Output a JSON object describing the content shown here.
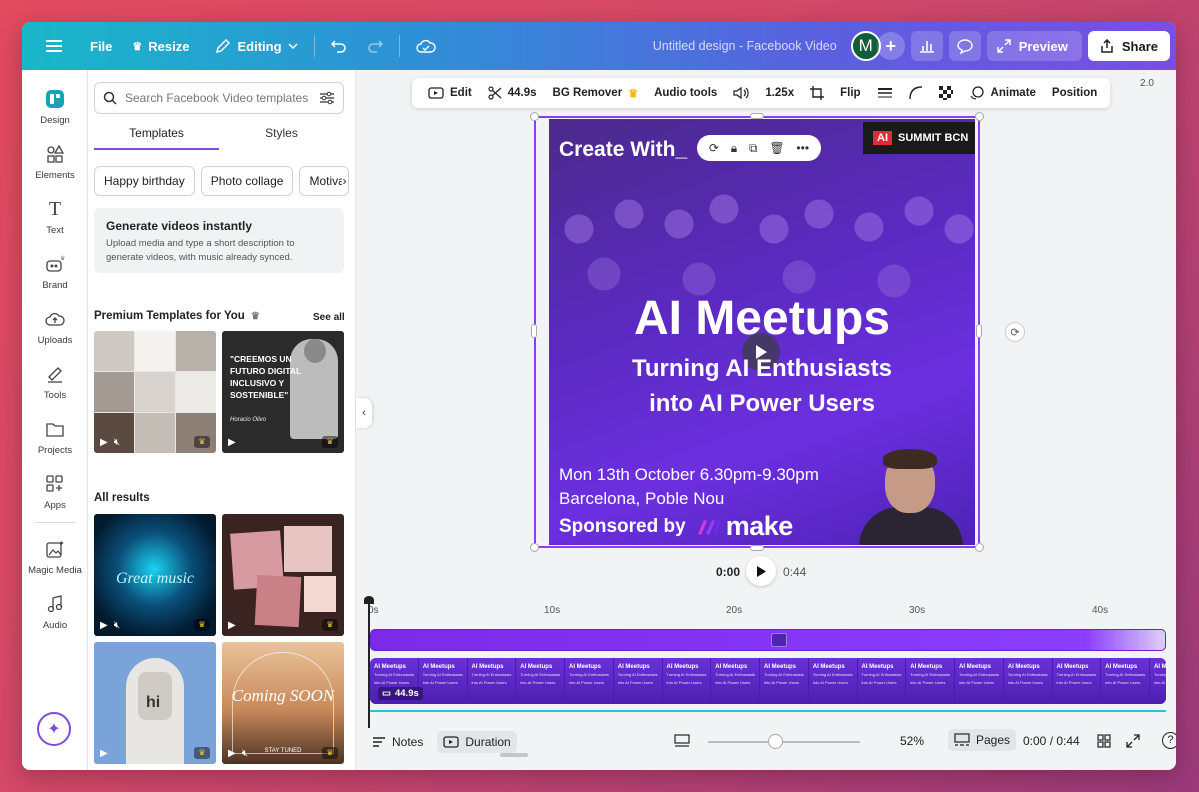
{
  "topbar": {
    "file": "File",
    "resize": "Resize",
    "editing": "Editing",
    "title": "Untitled design - Facebook Video",
    "avatar_initial": "M",
    "preview": "Preview",
    "share": "Share"
  },
  "rail": {
    "items": [
      {
        "label": "Design",
        "icon": "design-icon"
      },
      {
        "label": "Elements",
        "icon": "elements-icon"
      },
      {
        "label": "Text",
        "icon": "text-icon"
      },
      {
        "label": "Brand",
        "icon": "brand-icon"
      },
      {
        "label": "Uploads",
        "icon": "uploads-icon"
      },
      {
        "label": "Tools",
        "icon": "tools-icon"
      },
      {
        "label": "Projects",
        "icon": "projects-icon"
      },
      {
        "label": "Apps",
        "icon": "apps-icon"
      },
      {
        "label": "Magic Media",
        "icon": "magic-media-icon"
      },
      {
        "label": "Audio",
        "icon": "audio-icon"
      }
    ]
  },
  "panel": {
    "search_placeholder": "Search Facebook Video templates",
    "tabs": [
      "Templates",
      "Styles"
    ],
    "chips": [
      "Happy birthday",
      "Photo collage",
      "Motiva"
    ],
    "generate": {
      "title": "Generate videos instantly",
      "desc": "Upload media and type a short description to generate videos, with music already synced."
    },
    "premium_title": "Premium Templates for You",
    "see_all": "See all",
    "all_results": "All results",
    "template_quote": "\"CREEMOS UN FUTURO DIGITAL INCLUSIVO Y SOSTENIBLE\"",
    "template_sign": "Horacio Olivo",
    "great_music": "Great music",
    "coming_soon": "Coming SOON",
    "stay_tuned": "STAY TUNED"
  },
  "ctx": {
    "edit": "Edit",
    "duration": "44.9s",
    "bg_remover": "BG Remover",
    "audio_tools": "Audio tools",
    "speed": "1.25x",
    "flip": "Flip",
    "animate": "Animate",
    "position": "Position",
    "zoom_chip": "2.0"
  },
  "design": {
    "create_with": "Create With_",
    "summit_ai": "AI",
    "summit_text": "SUMMIT BCN",
    "title": "AI Meetups",
    "sub1": "Turning AI Enthusiasts",
    "sub2": "into AI Power Users",
    "date": "Mon 13th October 6.30pm-9.30pm",
    "place": "Barcelona, Poble Nou",
    "sponsored": "Sponsored by",
    "sponsor": "make"
  },
  "playback": {
    "current": "0:00",
    "total": "0:44"
  },
  "timeline": {
    "ruler": [
      "0s",
      "10s",
      "20s",
      "30s",
      "40s"
    ],
    "clip_duration": "44.9s",
    "frame_title": "AI Meetups",
    "frame_sub": "Turning AI Enthusiasts into AI Power Users"
  },
  "footer": {
    "notes": "Notes",
    "duration": "Duration",
    "zoom": "52%",
    "pages": "Pages",
    "time": "0:00 / 0:44"
  },
  "colors": {
    "accent": "#8b3dff",
    "topbar_start": "#19b7c9",
    "topbar_end": "#7a4ee3"
  }
}
